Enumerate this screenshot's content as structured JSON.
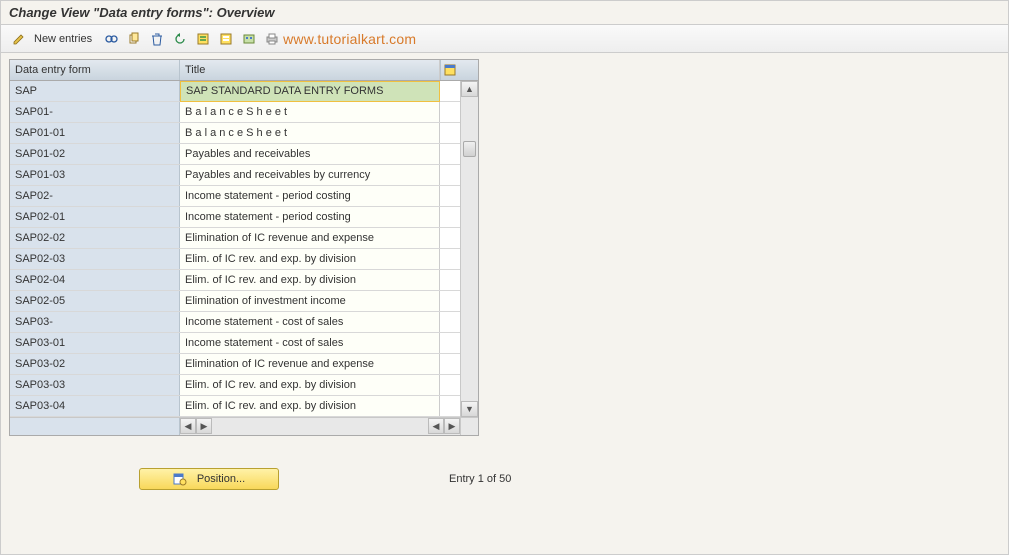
{
  "title": "Change View \"Data entry forms\": Overview",
  "toolbar": {
    "new_entries": "New entries"
  },
  "watermark": "www.tutorialkart.com",
  "columns": {
    "key": "Data entry form",
    "title": "Title"
  },
  "rows": [
    {
      "key": "SAP",
      "title": "SAP STANDARD DATA ENTRY FORMS",
      "selected": true
    },
    {
      "key": "SAP01-",
      "title": "B a l a n c e   S h e e t",
      "spaced": false
    },
    {
      "key": "SAP01-01",
      "title": "B a l a n c e   S h e e t",
      "spaced": false
    },
    {
      "key": "SAP01-02",
      "title": "Payables and receivables"
    },
    {
      "key": "SAP01-03",
      "title": "Payables and receivables by currency"
    },
    {
      "key": "SAP02-",
      "title": "Income statement - period costing"
    },
    {
      "key": "SAP02-01",
      "title": "Income statement - period costing"
    },
    {
      "key": "SAP02-02",
      "title": "Elimination of IC revenue and expense"
    },
    {
      "key": "SAP02-03",
      "title": "Elim. of IC rev. and exp. by division"
    },
    {
      "key": "SAP02-04",
      "title": "Elim. of IC rev. and exp. by division"
    },
    {
      "key": "SAP02-05",
      "title": "Elimination of investment income"
    },
    {
      "key": "SAP03-",
      "title": "Income statement - cost of sales"
    },
    {
      "key": "SAP03-01",
      "title": "Income statement - cost of sales"
    },
    {
      "key": "SAP03-02",
      "title": "Elimination of IC revenue and expense"
    },
    {
      "key": "SAP03-03",
      "title": "Elim. of IC rev. and exp. by division"
    },
    {
      "key": "SAP03-04",
      "title": "Elim. of IC rev. and exp. by division"
    }
  ],
  "footer": {
    "position_label": "Position...",
    "entry_status": "Entry 1 of 50"
  },
  "icons": {
    "pencil": "pencil-icon",
    "glasses": "details-icon",
    "copy": "copy-icon",
    "delete": "delete-icon",
    "undo": "undo-icon",
    "select_all": "select-all-icon",
    "deselect_all": "deselect-all-icon",
    "config": "config-icon",
    "print": "print-icon",
    "table_settings": "table-settings-icon"
  }
}
